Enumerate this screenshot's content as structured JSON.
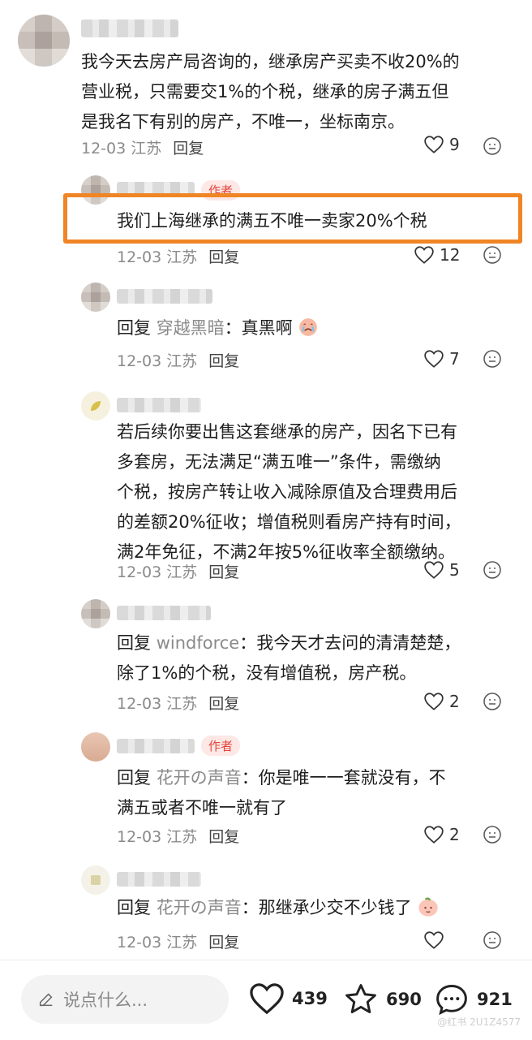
{
  "comments": [
    {
      "text_lines": [
        "我今天去房产局咨询的，继承房产买卖不收20%的",
        "营业税，只需要交1%的个税，继承的房子满五但",
        "是我名下有别的房产，不唯一，坐标南京。"
      ],
      "date": "12-03",
      "location": "江苏",
      "reply_label": "回复",
      "likes": "9"
    },
    {
      "badge": "作者",
      "text_lines": [
        "我们上海继承的满五不唯一卖家20%个税"
      ],
      "date": "12-03",
      "location": "江苏",
      "reply_label": "回复",
      "likes": "12"
    },
    {
      "reply_prefix": "回复",
      "reply_to": "穿越黑暗",
      "text_lines": [
        "：真黑啊"
      ],
      "date": "12-03",
      "location": "江苏",
      "reply_label": "回复",
      "likes": "7"
    },
    {
      "text_lines": [
        "若后续你要出售这套继承的房产，因名下已有",
        "多套房，无法满足“满五唯一”条件，需缴纳",
        "个税，按房产转让收入减除原值及合理费用后",
        "的差额20%征收；增值税则看房产持有时间，",
        "满2年免征，不满2年按5%征收率全额缴纳。"
      ],
      "date": "12-03",
      "location": "江苏",
      "reply_label": "回复",
      "likes": "5"
    },
    {
      "reply_prefix": "回复",
      "reply_to": "windforce",
      "text_lines": [
        "：我今天才去问的清清楚楚，",
        "除了1%的个税，没有增值税，房产税。"
      ],
      "date": "12-03",
      "location": "江苏",
      "reply_label": "回复",
      "likes": "2"
    },
    {
      "badge": "作者",
      "reply_prefix": "回复",
      "reply_to": "花开の声音",
      "text_lines": [
        "：你是唯一一套就没有，不",
        "满五或者不唯一就有了"
      ],
      "date": "12-03",
      "location": "江苏",
      "reply_label": "回复",
      "likes": "2"
    },
    {
      "reply_prefix": "回复",
      "reply_to": "花开の声音",
      "text_lines": [
        "：那继承少交不少钱了"
      ],
      "date": "12-03",
      "location": "江苏",
      "reply_label": "回复",
      "likes": ""
    }
  ],
  "bottom_bar": {
    "input_placeholder": "说点什么...",
    "likes": "439",
    "stars": "690",
    "comments": "921"
  },
  "watermark": "@红书 2U1Z4577",
  "colors": {
    "highlight": "#f08526",
    "badge": "#e2463e",
    "meta": "#8a8a8a"
  }
}
